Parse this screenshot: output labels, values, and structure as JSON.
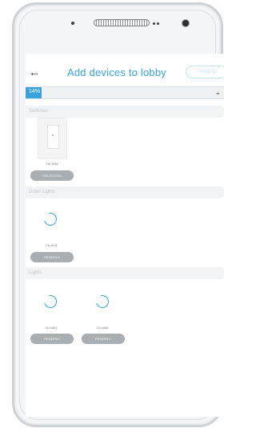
{
  "header": {
    "back_icon": "arrow-left-icon",
    "title": "Add devices to lobby",
    "pending_label": "Pending"
  },
  "progress": {
    "percent_label": "14%",
    "value": 0.14,
    "dropdown_icon": "chevron-down-icon"
  },
  "sections": [
    {
      "label": "Switches"
    },
    {
      "label": "Down Lights"
    },
    {
      "label": "Lights"
    }
  ],
  "switches": [
    {
      "name": "Ue 3652",
      "status": "SELECTED"
    }
  ],
  "down_lights": [
    {
      "name": "Cu 4b0t",
      "status": "PENDING"
    }
  ],
  "lights": [
    {
      "name": "Cu cd57",
      "status": "PENDING"
    },
    {
      "name": "Cu cdd8",
      "status": "PENDING"
    }
  ],
  "colors": {
    "accent": "#3aa3dc",
    "pill_gray": "#a9aeb2",
    "section_bg": "#f1f3f4"
  }
}
